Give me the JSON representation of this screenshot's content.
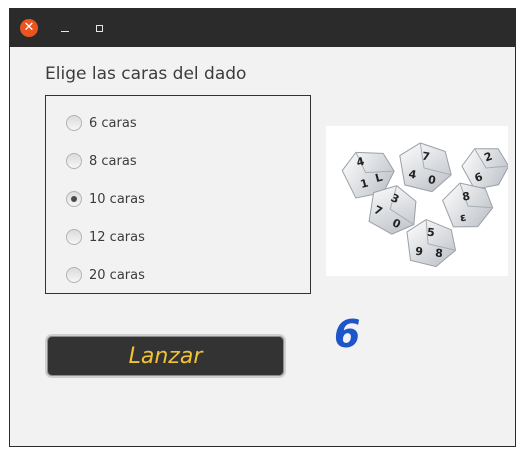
{
  "titlebar": {
    "close_glyph": "✕",
    "close_icon": "close-icon",
    "min_icon": "minimize-icon",
    "max_icon": "maximize-icon"
  },
  "heading": "Elige las caras del dado",
  "options": [
    "6 caras",
    "8 caras",
    "10 caras",
    "12 caras",
    "20 caras"
  ],
  "selected_option": "10 caras",
  "result": "6",
  "button_label": "Lanzar",
  "colors": {
    "accent": "#e95420",
    "result": "#1d56c9",
    "button_text": "#f1c232",
    "button_bg": "#333333"
  }
}
